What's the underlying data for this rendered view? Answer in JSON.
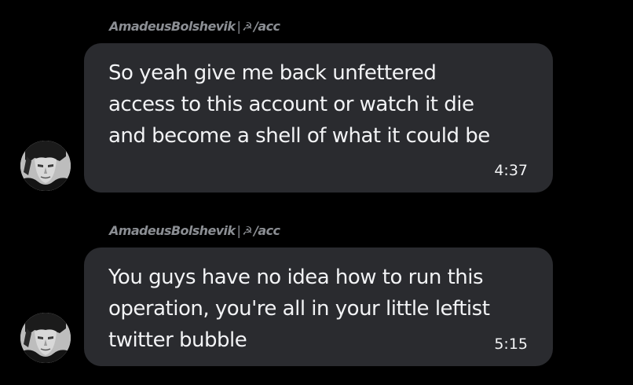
{
  "messages": [
    {
      "sender": "AmadeusBolshevik",
      "separator": "|",
      "badge_glyph": "☭",
      "badge_text": "/acc",
      "text": "So yeah give me back unfettered\naccess to this account or watch it die\nand become a shell of what it could be",
      "time": "4:37",
      "avatar_icon": "user-avatar-icon"
    },
    {
      "sender": "AmadeusBolshevik",
      "separator": "|",
      "badge_glyph": "☭",
      "badge_text": "/acc",
      "text": "You guys have no idea how to run this\noperation, you're all in your little leftist\ntwitter bubble",
      "time": "5:15",
      "avatar_icon": "user-avatar-icon"
    }
  ],
  "colors": {
    "background": "#000000",
    "bubble": "#2a2b2f",
    "text": "#f2f3f5",
    "sender": "#8b8e93"
  }
}
